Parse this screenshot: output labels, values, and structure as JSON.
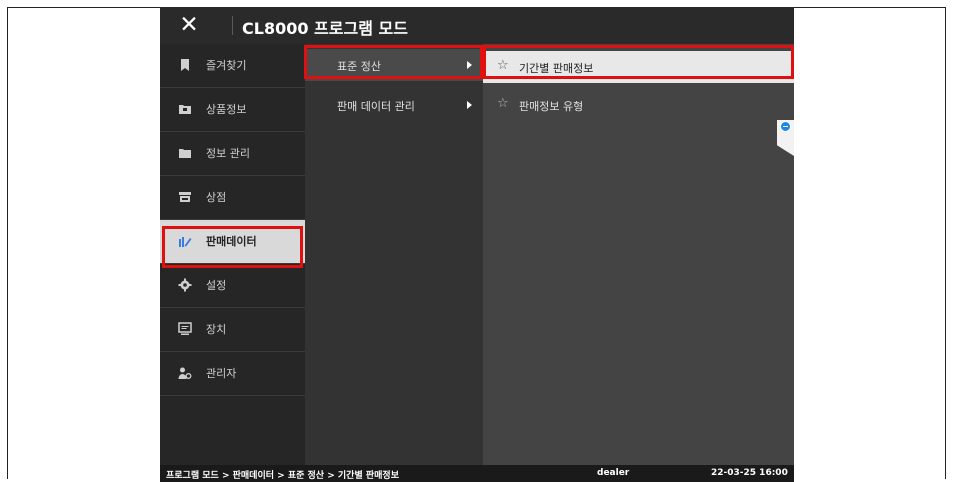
{
  "app": {
    "title": "CL8000 프로그램 모드"
  },
  "sidebar": {
    "items": [
      {
        "label": "즐겨찾기",
        "icon": "bookmark-icon"
      },
      {
        "label": "상품정보",
        "icon": "folder-box-icon"
      },
      {
        "label": "정보 관리",
        "icon": "folder-icon"
      },
      {
        "label": "상점",
        "icon": "store-icon"
      },
      {
        "label": "판매데이터",
        "icon": "edit-chart-icon",
        "active": true
      },
      {
        "label": "설정",
        "icon": "gear-icon"
      },
      {
        "label": "장치",
        "icon": "monitor-icon"
      },
      {
        "label": "관리자",
        "icon": "admin-user-icon"
      }
    ]
  },
  "submenu": {
    "items": [
      {
        "label": "표준 정산",
        "active": true
      },
      {
        "label": "판매 데이터 관리"
      }
    ]
  },
  "leaf": {
    "items": [
      {
        "label": "기간별 판매정보",
        "active": true
      },
      {
        "label": "판매정보 유형"
      }
    ]
  },
  "status": {
    "breadcrumb": "프로그램 모드 > 판매데이터 > 표준 정산 > 기간별 판매정보",
    "user": "dealer",
    "datetime": "22-03-25 16:00"
  },
  "colors": {
    "highlight": "#e01010",
    "accent": "#1e88e5"
  }
}
